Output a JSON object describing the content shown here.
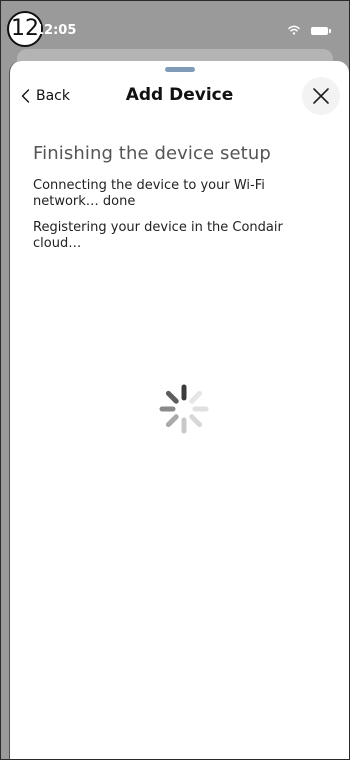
{
  "status_bar": {
    "step_number": "12",
    "time": "12:05",
    "wifi_icon": "wifi-icon",
    "battery_icon": "battery-icon"
  },
  "header": {
    "back_label": "Back",
    "back_icon": "chevron-left-icon",
    "title": "Add Device",
    "close_icon": "close-icon"
  },
  "content": {
    "heading": "Finishing the device setup",
    "steps": [
      "Connecting the device to your Wi-Fi network… done",
      "Registering your device in the Condair cloud…"
    ],
    "loading_icon": "spinner-icon"
  },
  "colors": {
    "backdrop": "#9a9a9a",
    "grabber": "#7f9bb9",
    "heading_text": "#555555"
  }
}
